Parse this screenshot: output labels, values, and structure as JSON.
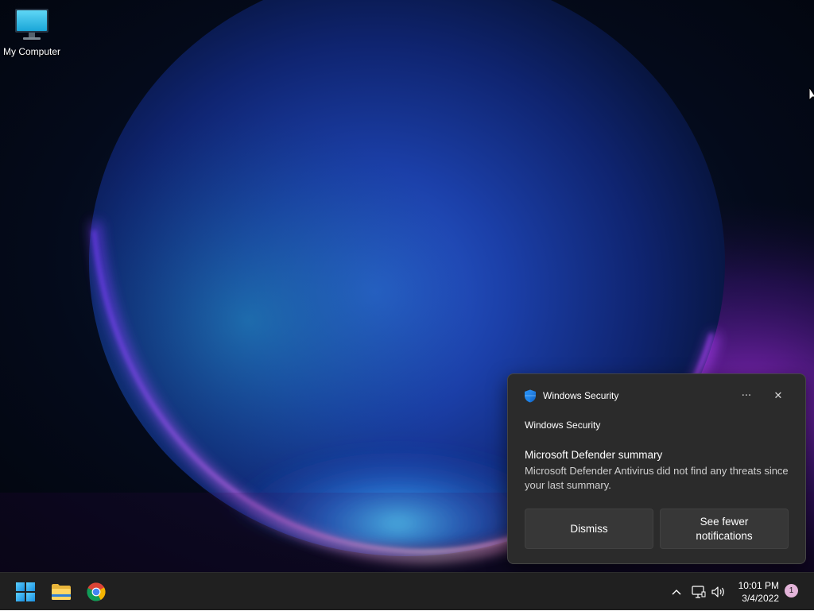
{
  "desktop": {
    "icons": [
      {
        "label": "My Computer",
        "icon": "monitor-icon"
      }
    ]
  },
  "toast": {
    "app_name": "Windows Security",
    "app_icon": "shield-icon",
    "attribution": "Windows Security",
    "title": "Microsoft Defender summary",
    "body": "Microsoft Defender Antivirus did not find any threats since your last summary.",
    "more_icon": "more-options-icon",
    "more_glyph": "···",
    "close_icon": "close-icon",
    "close_glyph": "✕",
    "buttons": {
      "dismiss": "Dismiss",
      "fewer": "See fewer notifications"
    }
  },
  "taskbar": {
    "pinned": [
      {
        "name": "Start",
        "icon": "windows-logo-icon"
      },
      {
        "name": "File Explorer",
        "icon": "folder-icon"
      },
      {
        "name": "Google Chrome",
        "icon": "chrome-icon"
      }
    ],
    "tray": {
      "overflow_icon": "chevron-up-icon",
      "network_icon": "network-icon",
      "volume_icon": "volume-icon"
    },
    "clock": {
      "time": "10:01 PM",
      "date": "3/4/2022"
    },
    "notification_count": "1"
  },
  "colors": {
    "accent_blue": "#0078d4",
    "toast_bg": "#2b2b2b",
    "taskbar_bg": "#202020",
    "badge": "#e3b4d9"
  }
}
